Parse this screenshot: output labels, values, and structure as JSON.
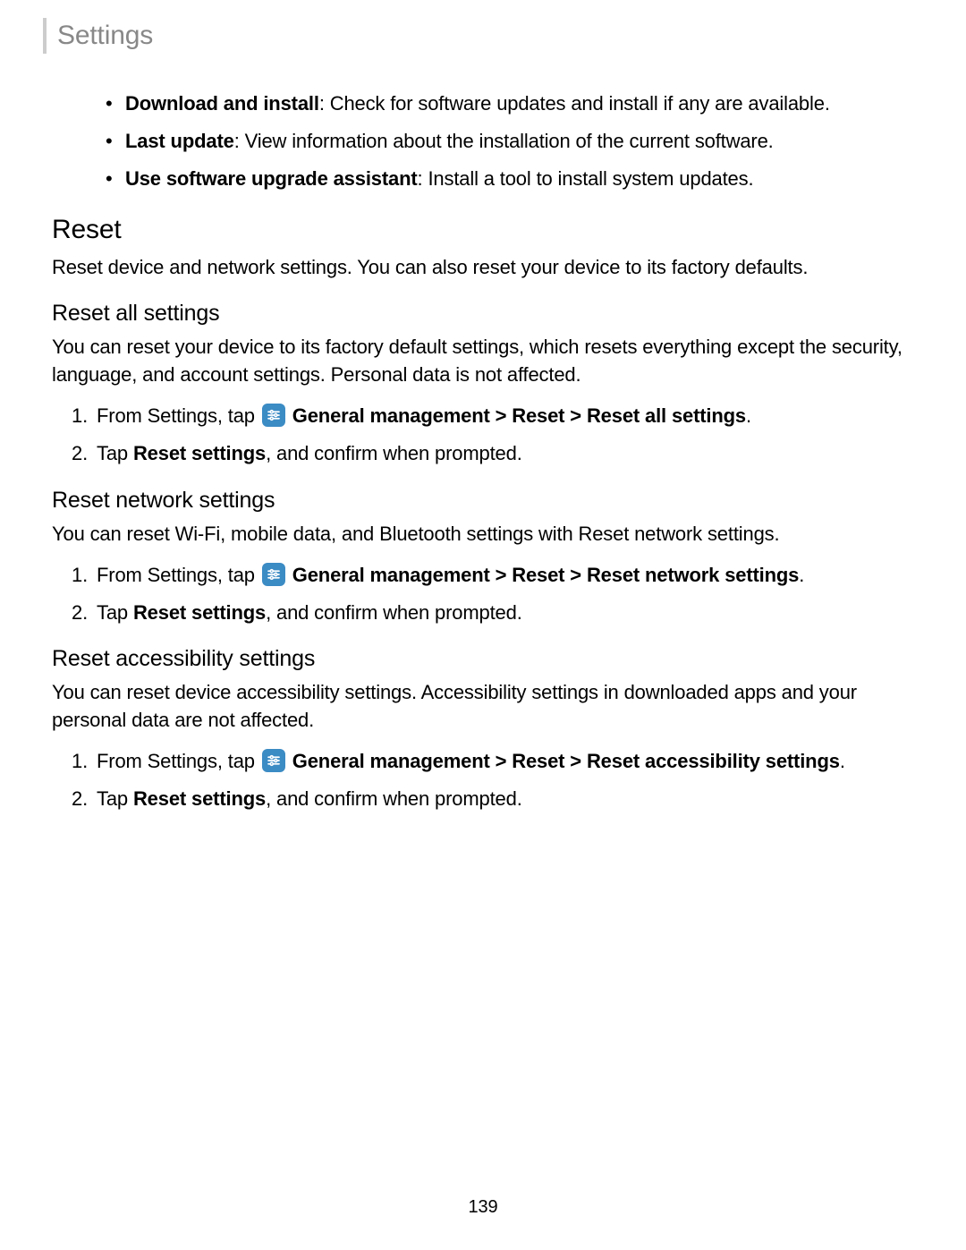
{
  "header": {
    "title": "Settings"
  },
  "softwareUpdateList": [
    {
      "bold": "Download and install",
      "text": ": Check for software updates and install if any are available."
    },
    {
      "bold": "Last update",
      "text": ": View information about the installation of the current software."
    },
    {
      "bold": "Use software upgrade assistant",
      "text": ": Install a tool to install system updates."
    }
  ],
  "reset": {
    "heading": "Reset",
    "intro": "Reset device and network settings. You can also reset your device to its factory defaults."
  },
  "resetAll": {
    "heading": "Reset all settings",
    "intro": "You can reset your device to its factory default settings, which resets everything except the security, language, and account settings. Personal data is not affected.",
    "steps": [
      {
        "pre": "From Settings, tap ",
        "bold": "General management > Reset > Reset all settings",
        "post": "."
      },
      {
        "pre": "Tap ",
        "bold": "Reset settings",
        "post": ", and confirm when prompted."
      }
    ]
  },
  "resetNetwork": {
    "heading": "Reset network settings",
    "intro": "You can reset Wi-Fi, mobile data, and Bluetooth settings with Reset network settings.",
    "steps": [
      {
        "pre": "From Settings, tap ",
        "bold": "General management > Reset > Reset network settings",
        "post": "."
      },
      {
        "pre": "Tap ",
        "bold": "Reset settings",
        "post": ", and confirm when prompted."
      }
    ]
  },
  "resetAccessibility": {
    "heading": "Reset accessibility settings",
    "intro": "You can reset device accessibility settings. Accessibility settings in downloaded apps and your personal data are not affected.",
    "steps": [
      {
        "pre": "From Settings, tap ",
        "bold": "General management > Reset > Reset accessibility settings",
        "post": "."
      },
      {
        "pre": "Tap ",
        "bold": "Reset settings",
        "post": ", and confirm when prompted."
      }
    ]
  },
  "pageNumber": "139"
}
